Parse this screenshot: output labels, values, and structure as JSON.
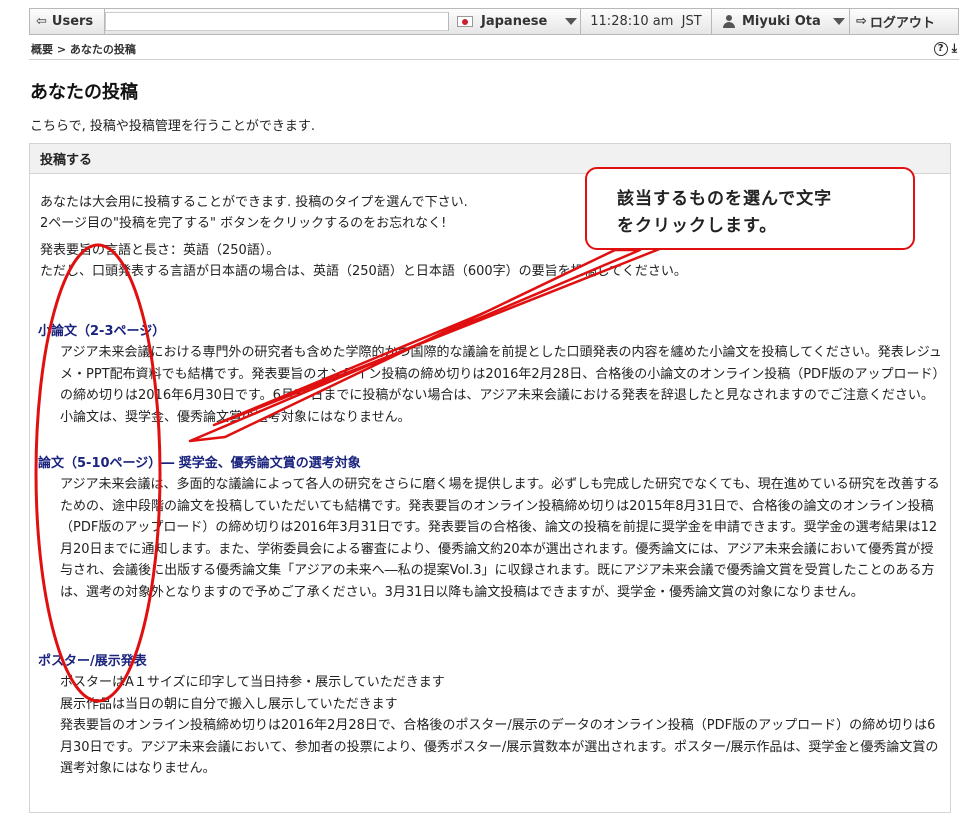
{
  "topbar": {
    "users_label": "Users",
    "language": "Japanese",
    "time": "11:28:10 am  JST",
    "user_name": "Miyuki Ota",
    "logout_label": "ログアウト"
  },
  "breadcrumb": {
    "text": "概要 > あなたの投稿"
  },
  "page": {
    "title": "あなたの投稿",
    "description": "こちらで, 投稿や投稿管理を行うことができます."
  },
  "panel": {
    "heading": "投稿する",
    "intro": [
      "あなたは大会用に投稿することができます. 投稿のタイプを選んで下さい.",
      "2ページ目の\"投稿を完了する\" ボタンをクリックするのをお忘れなく!",
      "発表要旨の言語と長さ：英語（250語）。",
      "ただし、口頭発表する言語が日本語の場合は、英語（250語）と日本語（600字）の要旨を投稿してください。"
    ],
    "sections": [
      {
        "title": "小論文（2-3ページ）",
        "body": "アジア未来会議における専門外の研究者も含めた学際的かつ国際的な議論を前提とした口頭発表の内容を纏めた小論文を投稿してください。発表レジュメ・PPT配布資料でも結構です。発表要旨のオンライン投稿の締め切りは2016年2月28日、合格後の小論文のオンライン投稿（PDF版のアップロード）の締め切りは2016年6月30日です。6月30日までに投稿がない場合は、アジア未来会議における発表を辞退したと見なされますのでご注意ください。小論文は、奨学金、優秀論文賞の選考対象にはなりません。"
      },
      {
        "title": "論文（5-10ページ）― 奨学金、優秀論文賞の選考対象",
        "body": "アジア未来会議は、多面的な議論によって各人の研究をさらに磨く場を提供します。必ずしも完成した研究でなくても、現在進めている研究を改善するための、途中段階の論文を投稿していただいても結構です。発表要旨のオンライン投稿締め切りは2015年8月31日で、合格後の論文のオンライン投稿（PDF版のアップロード）の締め切りは2016年3月31日です。発表要旨の合格後、論文の投稿を前提に奨学金を申請できます。奨学金の選考結果は12月20日までに通知します。また、学術委員会による審査により、優秀論文約20本が選出されます。優秀論文には、アジア未来会議において優秀賞が授与され、会議後に出版する優秀論文集「アジアの未来へ―私の提案Vol.3」に収録されます。既にアジア未来会議で優秀論文賞を受賞したことのある方は、選考の対象外となりますので予めご了承ください。3月31日以降も論文投稿はできますが、奨学金・優秀論文賞の対象になりません。"
      },
      {
        "title": "ポスター/展示発表",
        "lines": [
          "ポスターはA１サイズに印字して当日持参・展示していただきます",
          "展示作品は当日の朝に自分で搬入し展示していただきます",
          "発表要旨のオンライン投稿締め切りは2016年2月28日で、合格後のポスター/展示のデータのオンライン投稿（PDF版のアップロード）の締め切りは6月30日です。アジア未来会議において、参加者の投票により、優秀ポスター/展示賞数本が選出されます。ポスター/展示作品は、奨学金と優秀論文賞の選考対象にはなりません。"
        ]
      }
    ]
  },
  "annotation": {
    "callout_line1": "該当するものを選んで文字",
    "callout_line2": "をクリックします。",
    "color": "#e01010"
  }
}
